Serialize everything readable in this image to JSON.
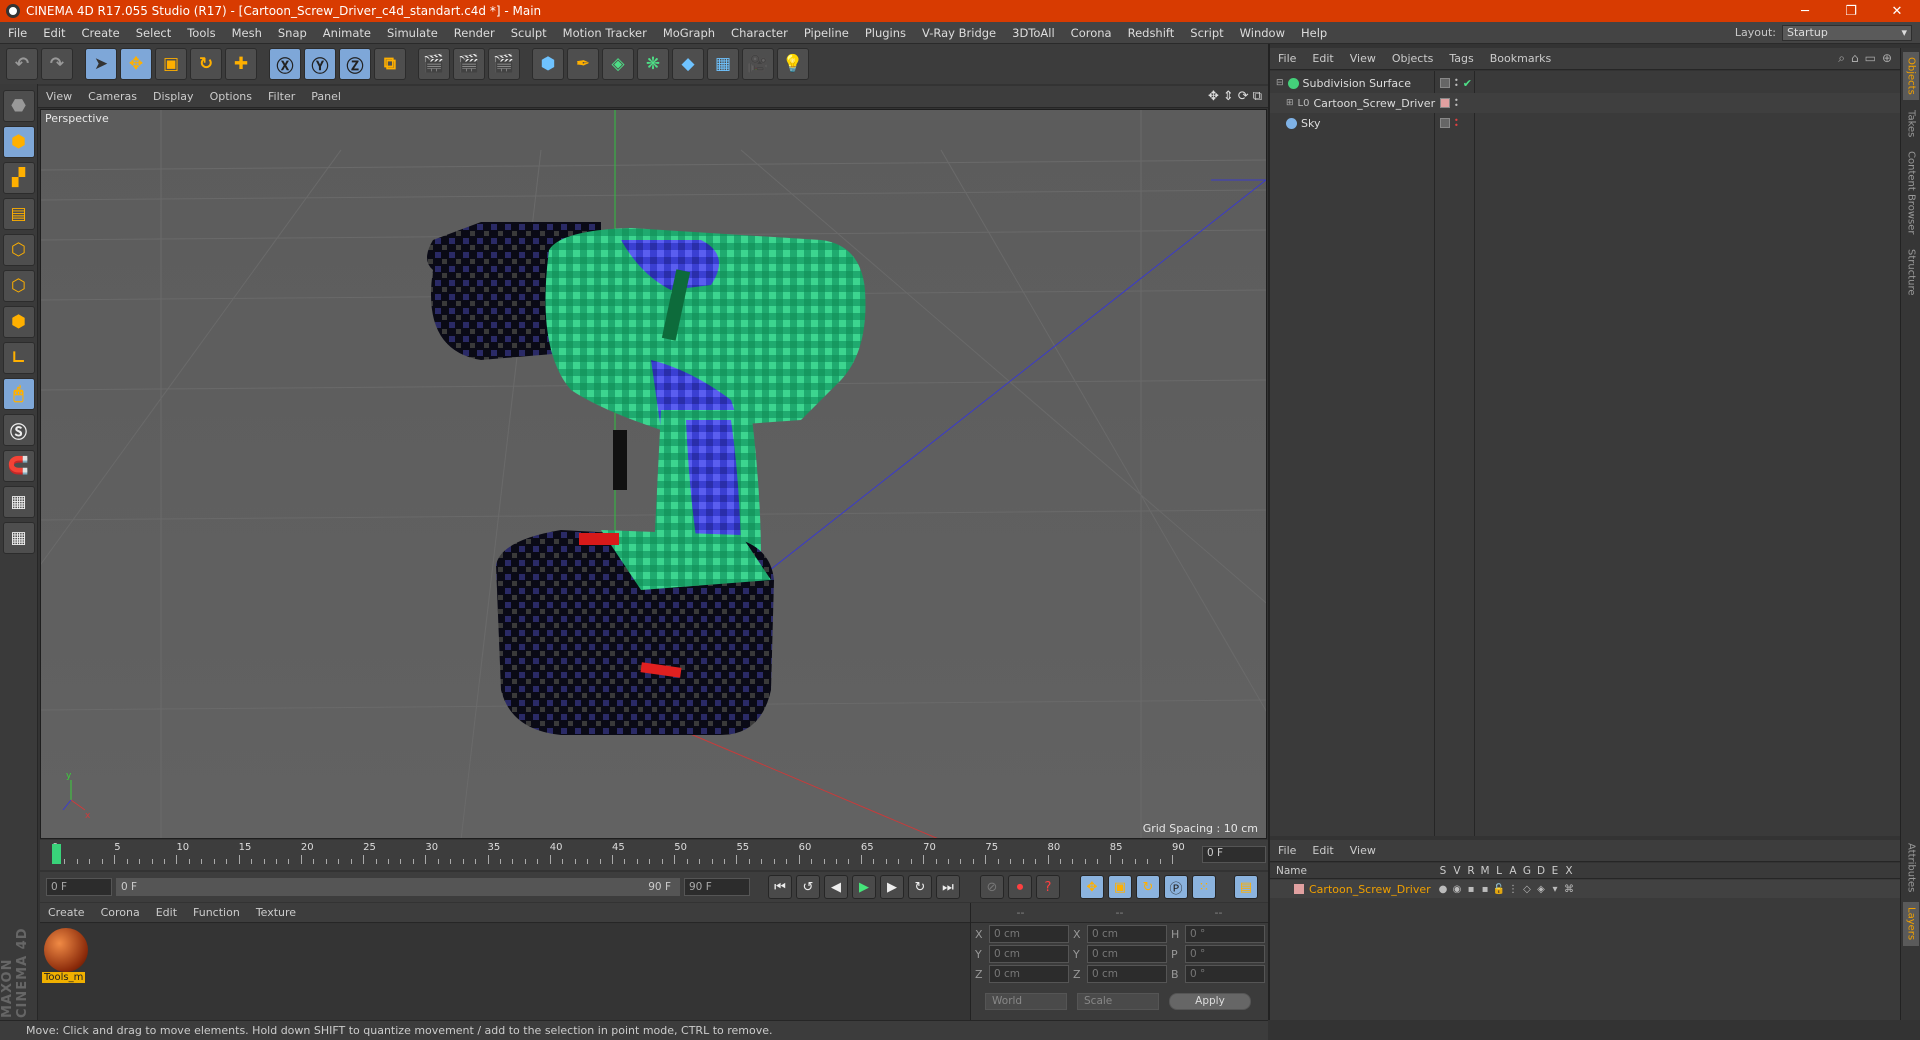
{
  "title": "CINEMA 4D R17.055 Studio (R17) - [Cartoon_Screw_Driver_c4d_standart.c4d *] - Main",
  "window_buttons": [
    "─",
    "❐",
    "✕"
  ],
  "menu": [
    "File",
    "Edit",
    "Create",
    "Select",
    "Tools",
    "Mesh",
    "Snap",
    "Animate",
    "Simulate",
    "Render",
    "Sculpt",
    "Motion Tracker",
    "MoGraph",
    "Character",
    "Pipeline",
    "Plugins",
    "V-Ray Bridge",
    "3DToAll",
    "Corona",
    "Redshift",
    "Script",
    "Window",
    "Help"
  ],
  "layout": {
    "label": "Layout:",
    "value": "Startup"
  },
  "viewport": {
    "menu": [
      "View",
      "Cameras",
      "Display",
      "Options",
      "Filter",
      "Panel"
    ],
    "label": "Perspective",
    "grid_spacing": "Grid Spacing : 10 cm"
  },
  "timeline": {
    "ticks": [
      0,
      5,
      10,
      15,
      20,
      25,
      30,
      35,
      40,
      45,
      50,
      55,
      60,
      65,
      70,
      75,
      80,
      85,
      90
    ],
    "current_frame": "0 F",
    "start": "0 F",
    "range_start": "0 F",
    "range_end": "90 F",
    "end": "90 F"
  },
  "material_manager": {
    "menu": [
      "Create",
      "Corona",
      "Edit",
      "Function",
      "Texture"
    ],
    "material_name": "Tools_m"
  },
  "coordinates": {
    "header": [
      "--",
      "--",
      "--"
    ],
    "rows": [
      {
        "a1": "X",
        "v1": "0 cm",
        "a2": "X",
        "v2": "0 cm",
        "a3": "H",
        "v3": "0 °"
      },
      {
        "a1": "Y",
        "v1": "0 cm",
        "a2": "Y",
        "v2": "0 cm",
        "a3": "P",
        "v3": "0 °"
      },
      {
        "a1": "Z",
        "v1": "0 cm",
        "a2": "Z",
        "v2": "0 cm",
        "a3": "B",
        "v3": "0 °"
      }
    ],
    "space": "World",
    "mode": "Scale",
    "apply": "Apply"
  },
  "status": "Move: Click and drag to move elements. Hold down SHIFT to quantize movement / add to the selection in point mode, CTRL to remove.",
  "brand": "MAXON CINEMA 4D",
  "object_manager": {
    "menu": [
      "File",
      "Edit",
      "View",
      "Objects",
      "Tags",
      "Bookmarks"
    ],
    "objects": [
      {
        "name": "Subdivision Surface",
        "color": "#44d07a"
      },
      {
        "name": "Cartoon_Screw_Driver",
        "color": "#c8c8c8"
      },
      {
        "name": "Sky",
        "color": "#7fb2e6"
      }
    ]
  },
  "layer_manager": {
    "menu": [
      "File",
      "Edit",
      "View"
    ],
    "columns": [
      "Name",
      "S",
      "V",
      "R",
      "M",
      "L",
      "A",
      "G",
      "D",
      "E",
      "X"
    ],
    "layer": "Cartoon_Screw_Driver"
  },
  "right_tabs": [
    "Objects",
    "Takes",
    "Content Browser",
    "Structure",
    "Attributes",
    "Layers"
  ],
  "colors": {
    "title_bar": "#d83b01",
    "accent": "#f0a000"
  }
}
